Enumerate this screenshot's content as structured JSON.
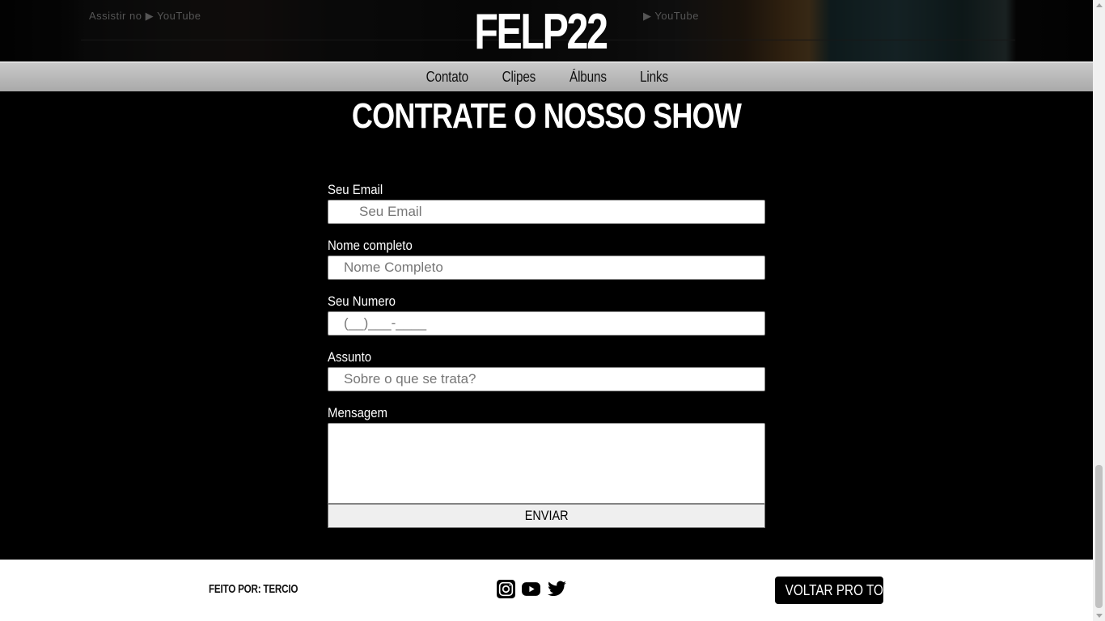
{
  "header": {
    "site_title": "FELP22",
    "hero_badge_left": "Assistir no  ▶ YouTube",
    "hero_badge_right": "▶ YouTube"
  },
  "nav": {
    "items": [
      {
        "label": "Contato"
      },
      {
        "label": "Clipes"
      },
      {
        "label": "Álbuns"
      },
      {
        "label": "Links"
      }
    ]
  },
  "section": {
    "title": "CONTRATE O NOSSO SHOW"
  },
  "form": {
    "email": {
      "label": "Seu Email",
      "placeholder": "Seu Email",
      "value": ""
    },
    "name": {
      "label": "Nome completo",
      "placeholder": "Nome Completo",
      "value": ""
    },
    "phone": {
      "label": "Seu Numero",
      "placeholder": "(__)___-____",
      "value": ""
    },
    "subject": {
      "label": "Assunto",
      "placeholder": "Sobre o que se trata?",
      "value": ""
    },
    "message": {
      "label": "Mensagem",
      "value": ""
    },
    "submit_label": "ENVIAR"
  },
  "footer": {
    "credit": "FEITO POR: TERCIO",
    "social": [
      {
        "icon": "instagram-icon"
      },
      {
        "icon": "youtube-icon"
      },
      {
        "icon": "twitter-icon"
      }
    ],
    "back_to_top_label": "VOLTAR PRO TOPO"
  }
}
